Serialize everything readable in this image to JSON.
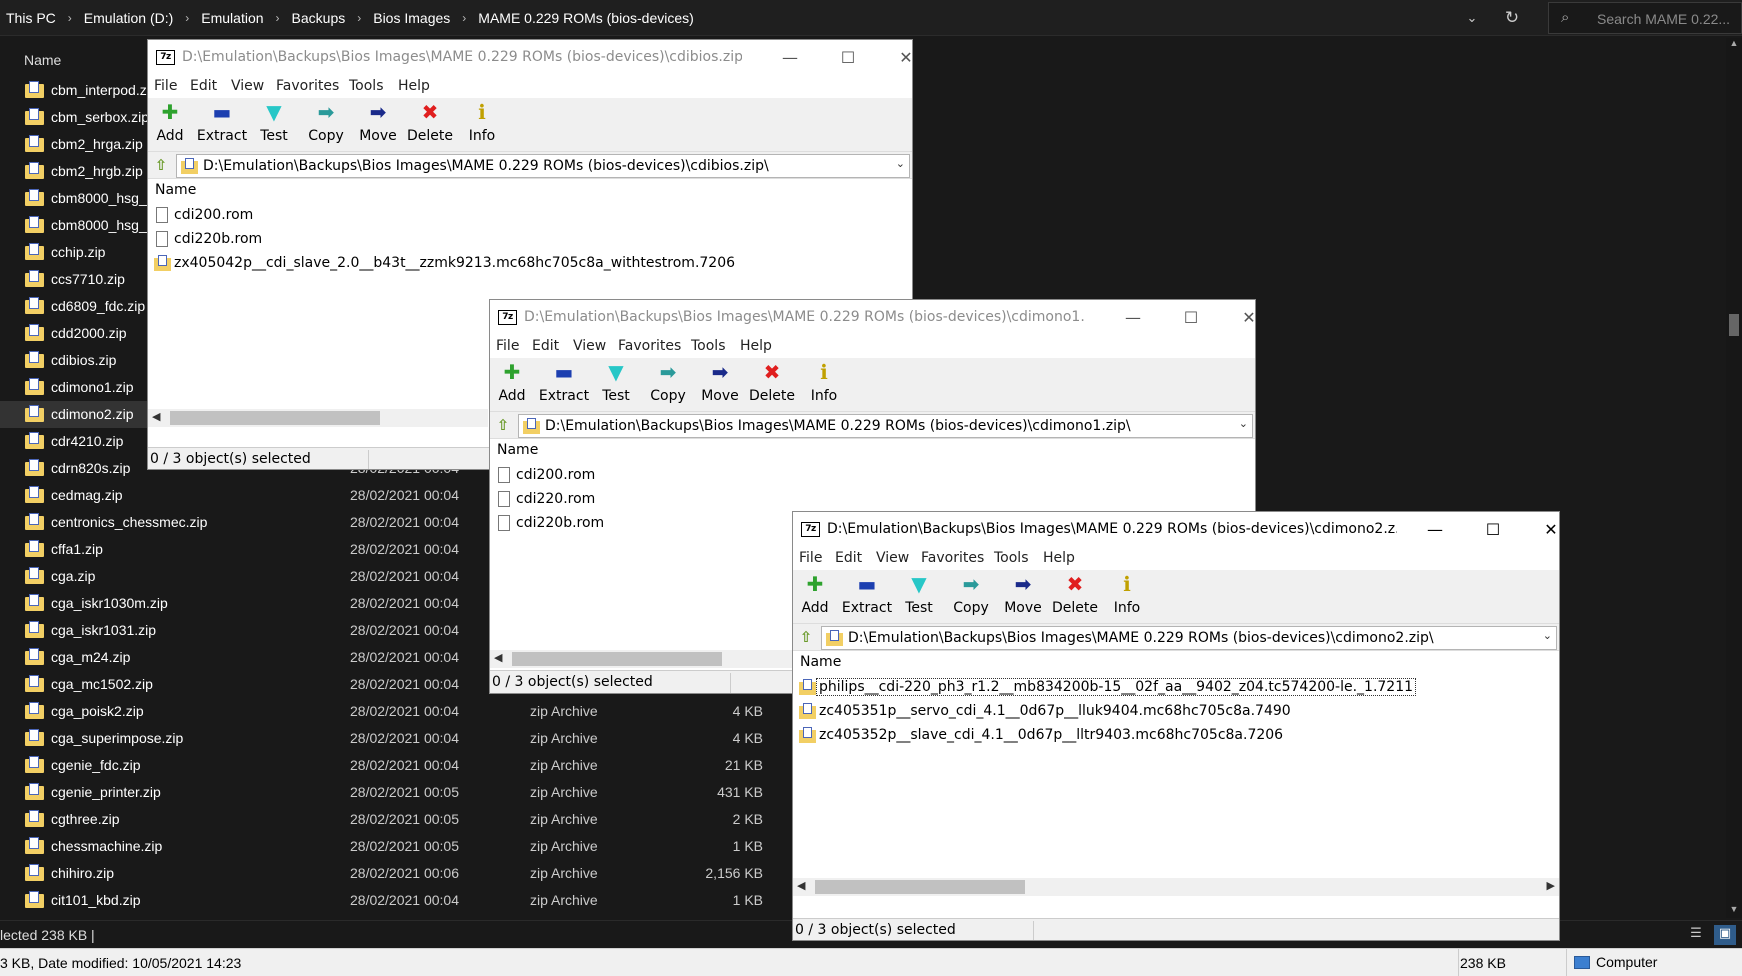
{
  "explorer": {
    "breadcrumb": [
      "This PC",
      "Emulation (D:)",
      "Emulation",
      "Backups",
      "Bios Images",
      "MAME 0.229 ROMs (bios-devices)"
    ],
    "search_placeholder": "Search MAME 0.22...",
    "column_name": "Name",
    "files": [
      {
        "name": "cbm_interpod.zip",
        "date": "",
        "type": "",
        "size": ""
      },
      {
        "name": "cbm_serbox.zip",
        "date": "",
        "type": "",
        "size": ""
      },
      {
        "name": "cbm2_hrga.zip",
        "date": "",
        "type": "",
        "size": ""
      },
      {
        "name": "cbm2_hrgb.zip",
        "date": "",
        "type": "",
        "size": ""
      },
      {
        "name": "cbm8000_hsg_a.zip",
        "date": "",
        "type": "",
        "size": ""
      },
      {
        "name": "cbm8000_hsg_b.zip",
        "date": "",
        "type": "",
        "size": ""
      },
      {
        "name": "cchip.zip",
        "date": "",
        "type": "",
        "size": ""
      },
      {
        "name": "ccs7710.zip",
        "date": "",
        "type": "",
        "size": ""
      },
      {
        "name": "cd6809_fdc.zip",
        "date": "",
        "type": "",
        "size": ""
      },
      {
        "name": "cdd2000.zip",
        "date": "",
        "type": "",
        "size": ""
      },
      {
        "name": "cdibios.zip",
        "date": "",
        "type": "",
        "size": ""
      },
      {
        "name": "cdimono1.zip",
        "date": "",
        "type": "",
        "size": ""
      },
      {
        "name": "cdimono2.zip",
        "date": "",
        "type": "",
        "size": "",
        "selected": true
      },
      {
        "name": "cdr4210.zip",
        "date": "",
        "type": "",
        "size": ""
      },
      {
        "name": "cdrn820s.zip",
        "date": "28/02/2021 00:04",
        "type": "",
        "size": ""
      },
      {
        "name": "cedmag.zip",
        "date": "28/02/2021 00:04",
        "type": "",
        "size": ""
      },
      {
        "name": "centronics_chessmec.zip",
        "date": "28/02/2021 00:04",
        "type": "",
        "size": ""
      },
      {
        "name": "cffa1.zip",
        "date": "28/02/2021 00:04",
        "type": "",
        "size": ""
      },
      {
        "name": "cga.zip",
        "date": "28/02/2021 00:04",
        "type": "",
        "size": ""
      },
      {
        "name": "cga_iskr1030m.zip",
        "date": "28/02/2021 00:04",
        "type": "",
        "size": ""
      },
      {
        "name": "cga_iskr1031.zip",
        "date": "28/02/2021 00:04",
        "type": "",
        "size": ""
      },
      {
        "name": "cga_m24.zip",
        "date": "28/02/2021 00:04",
        "type": "",
        "size": ""
      },
      {
        "name": "cga_mc1502.zip",
        "date": "28/02/2021 00:04",
        "type": "",
        "size": ""
      },
      {
        "name": "cga_poisk2.zip",
        "date": "28/02/2021 00:04",
        "type": "zip Archive",
        "size": "4 KB"
      },
      {
        "name": "cga_superimpose.zip",
        "date": "28/02/2021 00:04",
        "type": "zip Archive",
        "size": "4 KB"
      },
      {
        "name": "cgenie_fdc.zip",
        "date": "28/02/2021 00:04",
        "type": "zip Archive",
        "size": "21 KB"
      },
      {
        "name": "cgenie_printer.zip",
        "date": "28/02/2021 00:05",
        "type": "zip Archive",
        "size": "431 KB"
      },
      {
        "name": "cgthree.zip",
        "date": "28/02/2021 00:05",
        "type": "zip Archive",
        "size": "2 KB"
      },
      {
        "name": "chessmachine.zip",
        "date": "28/02/2021 00:05",
        "type": "zip Archive",
        "size": "1 KB"
      },
      {
        "name": "chihiro.zip",
        "date": "28/02/2021 00:06",
        "type": "zip Archive",
        "size": "2,156 KB"
      },
      {
        "name": "cit101_kbd.zip",
        "date": "28/02/2021 00:04",
        "type": "zip Archive",
        "size": "1 KB"
      }
    ],
    "status": "lected  238 KB  |",
    "details": "3 KB, Date modified: 10/05/2021 14:23",
    "details_size": "238 KB",
    "details_location": "Computer"
  },
  "sevenzip": {
    "menu": [
      "File",
      "Edit",
      "View",
      "Favorites",
      "Tools",
      "Help"
    ],
    "toolbar": [
      {
        "label": "Add",
        "glyph": "✚",
        "color": "#2ea22e"
      },
      {
        "label": "Extract",
        "glyph": "▬",
        "color": "#1c3fb0"
      },
      {
        "label": "Test",
        "glyph": "▼",
        "color": "#27c7c7"
      },
      {
        "label": "Copy",
        "glyph": "➡",
        "color": "#2a9a9a"
      },
      {
        "label": "Move",
        "glyph": "➡",
        "color": "#1a2a8a"
      },
      {
        "label": "Delete",
        "glyph": "✖",
        "color": "#e01e1e"
      },
      {
        "label": "Info",
        "glyph": "ℹ",
        "color": "#c0a000"
      }
    ],
    "list_header": "Name",
    "windows": [
      {
        "title": "D:\\Emulation\\Backups\\Bios Images\\MAME 0.229 ROMs (bios-devices)\\cdibios.zip\\",
        "path": "D:\\Emulation\\Backups\\Bios Images\\MAME 0.229 ROMs (bios-devices)\\cdibios.zip\\",
        "items": [
          {
            "name": "cdi200.rom",
            "kind": "file"
          },
          {
            "name": "cdi220b.rom",
            "kind": "file"
          },
          {
            "name": "zx405042p__cdi_slave_2.0__b43t__zzmk9213.mc68hc705c8a_withtestrom.7206",
            "kind": "folder"
          }
        ],
        "status": "0 / 3 object(s) selected"
      },
      {
        "title": "D:\\Emulation\\Backups\\Bios Images\\MAME 0.229 ROMs (bios-devices)\\cdimono1.z...",
        "path": "D:\\Emulation\\Backups\\Bios Images\\MAME 0.229 ROMs (bios-devices)\\cdimono1.zip\\",
        "items": [
          {
            "name": "cdi200.rom",
            "kind": "file"
          },
          {
            "name": "cdi220.rom",
            "kind": "file"
          },
          {
            "name": "cdi220b.rom",
            "kind": "file"
          }
        ],
        "status": "0 / 3 object(s) selected"
      },
      {
        "title": "D:\\Emulation\\Backups\\Bios Images\\MAME 0.229 ROMs (bios-devices)\\cdimono2.z...",
        "path": "D:\\Emulation\\Backups\\Bios Images\\MAME 0.229 ROMs (bios-devices)\\cdimono2.zip\\",
        "items": [
          {
            "name": "philips__cdi-220_ph3_r1.2__mb834200b-15__02f_aa__9402_z04.tc574200-le._1.7211",
            "kind": "folder",
            "focused": true
          },
          {
            "name": "zc405351p__servo_cdi_4.1__0d67p__lluk9404.mc68hc705c8a.7490",
            "kind": "folder"
          },
          {
            "name": "zc405352p__slave_cdi_4.1__0d67p__lltr9403.mc68hc705c8a.7206",
            "kind": "folder"
          }
        ],
        "status": "0 / 3 object(s) selected"
      }
    ]
  }
}
